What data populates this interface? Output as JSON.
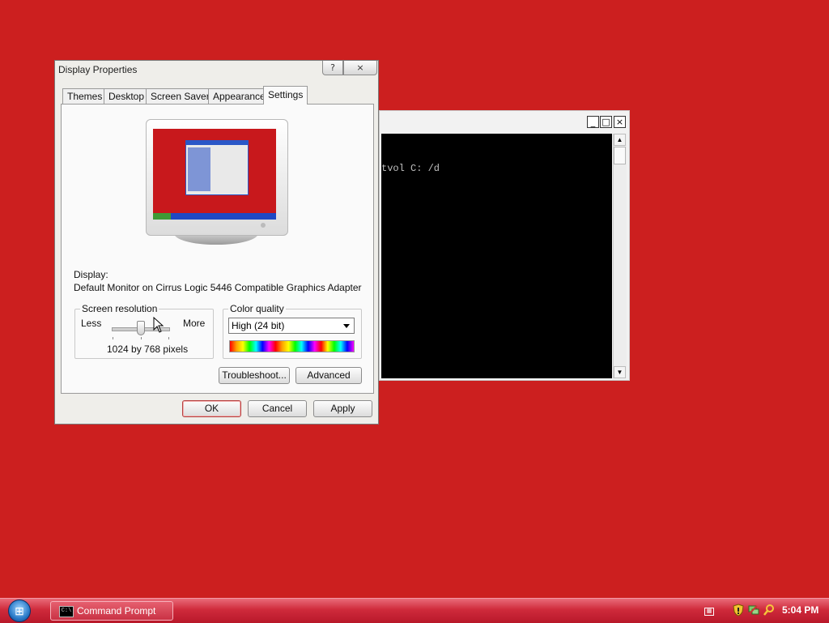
{
  "console": {
    "minimize_glyph": "_",
    "maximize_glyph": "□",
    "close_glyph": "×",
    "visible_text": "tvol C: /d",
    "scroll_up_glyph": "▲",
    "scroll_down_glyph": "▼"
  },
  "dialog": {
    "title": "Display Properties",
    "help_glyph": "?",
    "close_glyph": "×",
    "tabs": [
      {
        "label": "Themes"
      },
      {
        "label": "Desktop"
      },
      {
        "label": "Screen Saver"
      },
      {
        "label": "Appearance"
      },
      {
        "label": "Settings"
      }
    ],
    "active_tab": "Settings",
    "display_label": "Display:",
    "display_value": "Default Monitor on Cirrus Logic 5446 Compatible Graphics Adapter",
    "resolution": {
      "group_label": "Screen resolution",
      "less_label": "Less",
      "more_label": "More",
      "value_text": "1024 by 768 pixels",
      "slider_position_fraction": 0.5
    },
    "color_quality": {
      "group_label": "Color quality",
      "selected": "High (24 bit)"
    },
    "buttons": {
      "troubleshoot": "Troubleshoot...",
      "advanced": "Advanced",
      "ok": "OK",
      "cancel": "Cancel",
      "apply": "Apply"
    }
  },
  "taskbar": {
    "start_icon": "windows-orb-icon",
    "items": [
      {
        "label": "Command Prompt",
        "icon": "command-prompt-icon",
        "icon_text": "C:\\"
      }
    ],
    "tray_icons": [
      "keyboard-icon",
      "security-shield-icon",
      "network-icon",
      "search-icon"
    ],
    "clock": "5:04 PM"
  },
  "colors": {
    "desktop": "#cc1f1f",
    "taskbar": "#cf2a3b"
  }
}
